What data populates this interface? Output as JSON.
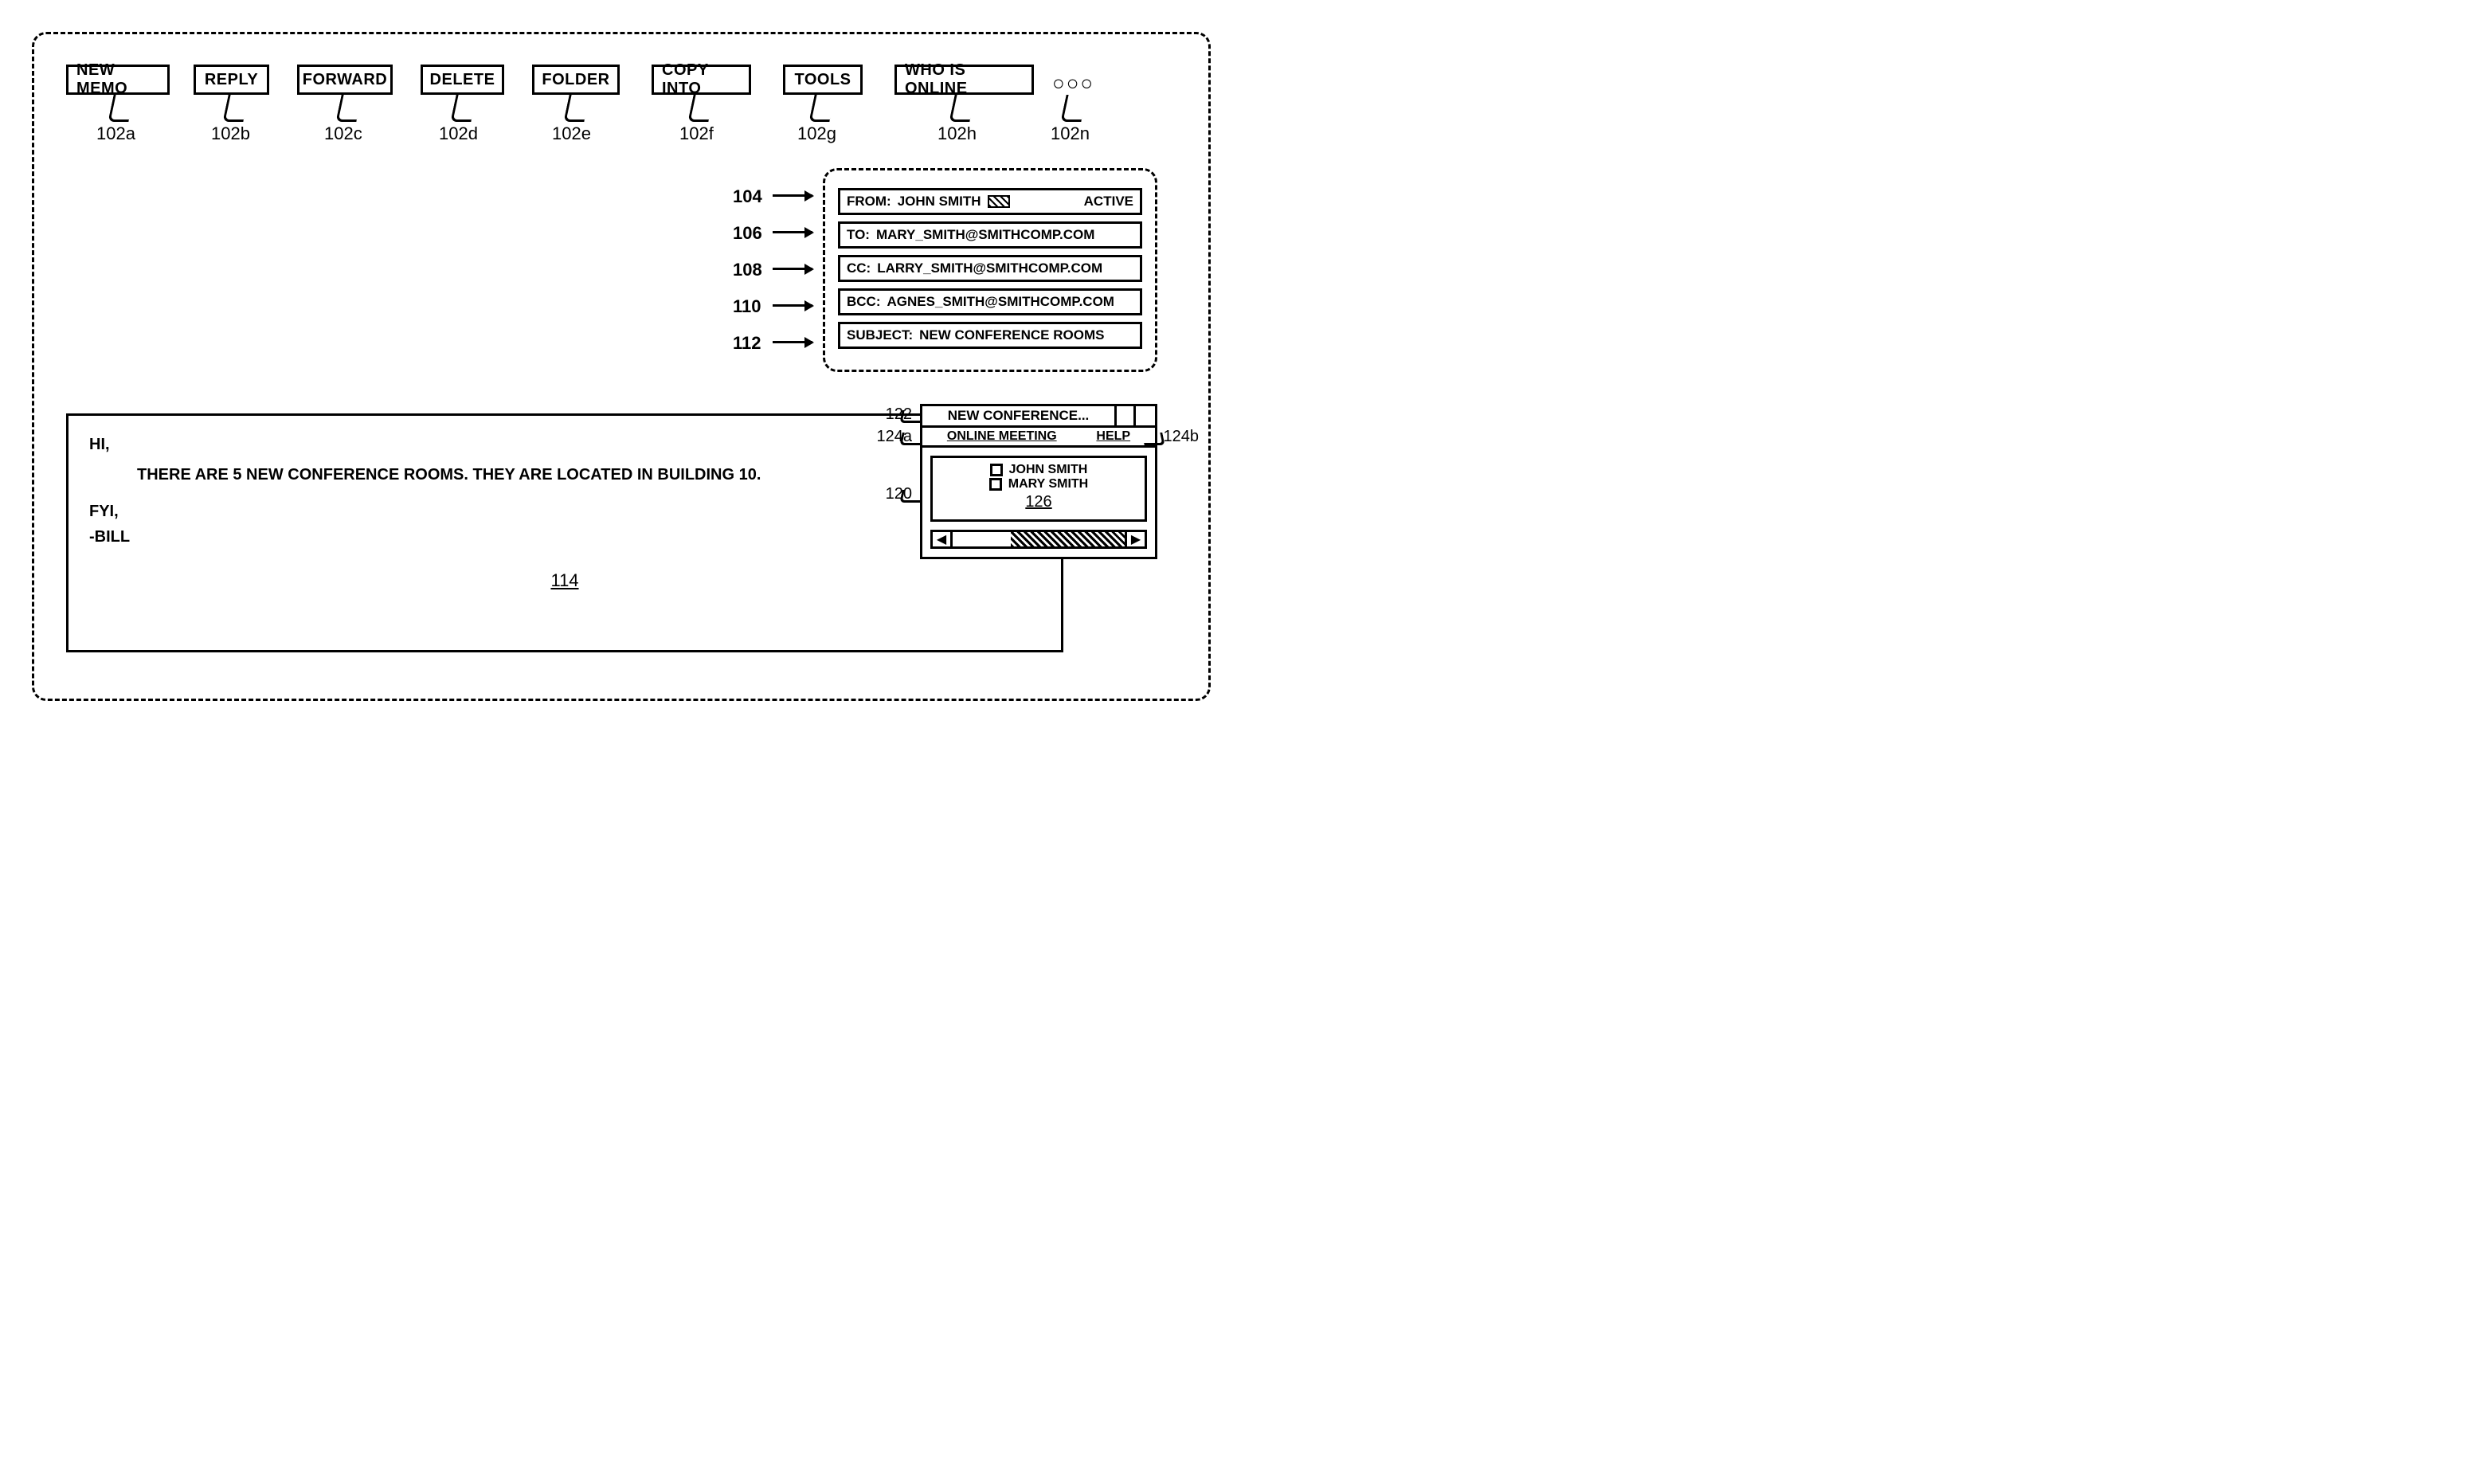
{
  "toolbar": {
    "buttons": [
      {
        "label": "NEW MEMO",
        "ref": "102a"
      },
      {
        "label": "REPLY",
        "ref": "102b"
      },
      {
        "label": "FORWARD",
        "ref": "102c"
      },
      {
        "label": "DELETE",
        "ref": "102d"
      },
      {
        "label": "FOLDER",
        "ref": "102e"
      },
      {
        "label": "COPY INTO",
        "ref": "102f"
      },
      {
        "label": "TOOLS",
        "ref": "102g"
      },
      {
        "label": "WHO IS ONLINE",
        "ref": "102h"
      }
    ],
    "overflow_glyph": "○○○",
    "overflow_ref": "102n"
  },
  "headers": {
    "from": {
      "label": "FROM:",
      "value": "JOHN SMITH",
      "status": "ACTIVE",
      "ref": "104"
    },
    "to": {
      "label": "TO:",
      "value": "MARY_SMITH@SMITHCOMP.COM",
      "ref": "106"
    },
    "cc": {
      "label": "CC:",
      "value": "LARRY_SMITH@SMITHCOMP.COM",
      "ref": "108"
    },
    "bcc": {
      "label": "BCC:",
      "value": "AGNES_SMITH@SMITHCOMP.COM",
      "ref": "110"
    },
    "subject": {
      "label": "SUBJECT:",
      "value": "NEW CONFERENCE ROOMS",
      "ref": "112"
    }
  },
  "body": {
    "greeting": "HI,",
    "paragraph": "THERE ARE 5 NEW CONFERENCE ROOMS. THEY ARE LOCATED IN BUILDING 10.",
    "closing1": "FYI,",
    "closing2": "-BILL",
    "ref": "114"
  },
  "popout": {
    "title": "NEW CONFERENCE...",
    "title_ref": "122",
    "menu": {
      "left": "ONLINE MEETING",
      "right": "HELP",
      "left_ref": "124a",
      "right_ref": "124b"
    },
    "participants": [
      "JOHN SMITH",
      "MARY SMITH"
    ],
    "list_ref": "126",
    "panel_ref": "120"
  }
}
